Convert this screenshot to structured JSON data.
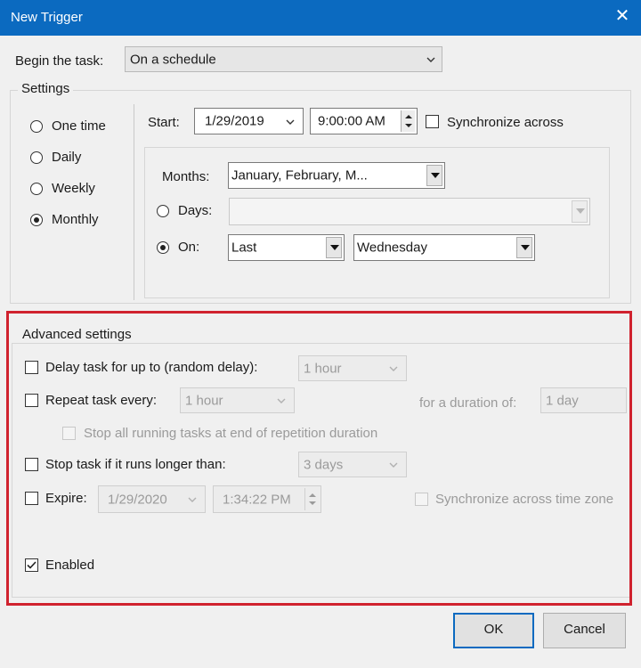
{
  "window": {
    "title": "New Trigger",
    "close_glyph": "✕"
  },
  "begin": {
    "label": "Begin the task:",
    "value": "On a schedule"
  },
  "settings": {
    "label": "Settings",
    "radios": [
      {
        "label": "One time",
        "selected": false
      },
      {
        "label": "Daily",
        "selected": false
      },
      {
        "label": "Weekly",
        "selected": false
      },
      {
        "label": "Monthly",
        "selected": true
      }
    ],
    "start_label": "Start:",
    "start_date": "1/29/2019",
    "start_time": "9:00:00 AM",
    "sync_label": "Synchronize across",
    "months_label": "Months:",
    "months_value": "January, February, M...",
    "days_label": "Days:",
    "on_label": "On:",
    "on_week": "Last",
    "on_day": "Wednesday"
  },
  "advanced": {
    "label": "Advanced settings",
    "delay_label": "Delay task for up to (random delay):",
    "delay_value": "1 hour",
    "repeat_label": "Repeat task every:",
    "repeat_value": "1 hour",
    "duration_label": "for a duration of:",
    "duration_value": "1 day",
    "stop_all_label": "Stop all running tasks at end of repetition duration",
    "stop_longer_label": "Stop task if it runs longer than:",
    "stop_longer_value": "3 days",
    "expire_label": "Expire:",
    "expire_date": "1/29/2020",
    "expire_time": "1:34:22 PM",
    "sync_tz_label": "Synchronize across time zone",
    "enabled_label": "Enabled",
    "enabled": true
  },
  "buttons": {
    "ok": "OK",
    "cancel": "Cancel"
  },
  "colors": {
    "titlebar": "#0b6ac0",
    "highlight": "#d0222e"
  }
}
